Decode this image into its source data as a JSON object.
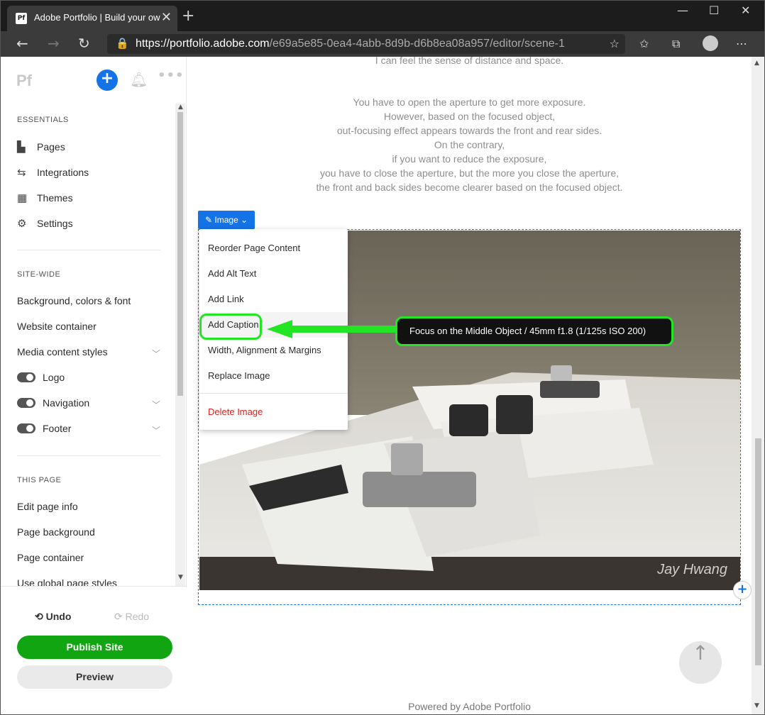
{
  "browser": {
    "tab_title": "Adobe Portfolio | Build your own",
    "tab_favicon": "Pf",
    "url_host": "https://portfolio.adobe.com",
    "url_path": "/e69a5e85-0ea4-4abb-8d9b-d6b8ea08a957/editor/scene-1"
  },
  "sidebar": {
    "logo": "Pf",
    "essentials": {
      "label": "ESSENTIALS",
      "items": [
        {
          "label": "Pages",
          "icon": "page-icon"
        },
        {
          "label": "Integrations",
          "icon": "arrows-swap-icon"
        },
        {
          "label": "Themes",
          "icon": "grid-icon"
        },
        {
          "label": "Settings",
          "icon": "gear-icon"
        }
      ]
    },
    "sitewide": {
      "label": "SITE-WIDE",
      "items": [
        {
          "label": "Background, colors & font"
        },
        {
          "label": "Website container"
        },
        {
          "label": "Media content styles"
        },
        {
          "label": "Logo"
        },
        {
          "label": "Navigation"
        },
        {
          "label": "Footer"
        }
      ]
    },
    "thispage": {
      "label": "THIS PAGE",
      "items": [
        {
          "label": "Edit page info"
        },
        {
          "label": "Page background"
        },
        {
          "label": "Page container"
        },
        {
          "label": "Use global page styles"
        }
      ]
    },
    "undo": "Undo",
    "redo": "Redo",
    "publish": "Publish Site",
    "preview": "Preview"
  },
  "main": {
    "partial_line": "I can feel the sense of distance and space.",
    "paragraph": [
      "You have to open the aperture to get more exposure.",
      "However, based on the focused object,",
      "out-focusing effect appears towards the front and rear sides.",
      "On the contrary,",
      "if you want to reduce the exposure,",
      "you have to close the aperture, but the more you close the aperture,",
      "the front and back sides become clearer based on the focused object."
    ],
    "image_tag": "Image",
    "menu": [
      "Reorder Page Content",
      "Add Alt Text",
      "Add Link",
      "Add Caption",
      "Width, Alignment & Margins",
      "Replace Image",
      "Delete Image"
    ],
    "caption_callout": "Focus on the Middle Object / 45mm f1.8 (1/125s ISO 200)",
    "watermark": "Jay Hwang",
    "footer": "Powered by Adobe Portfolio"
  },
  "colors": {
    "accent_blue": "#1473e6",
    "publish_green": "#12a512",
    "highlight_green": "#23e523",
    "danger_red": "#e02020"
  }
}
